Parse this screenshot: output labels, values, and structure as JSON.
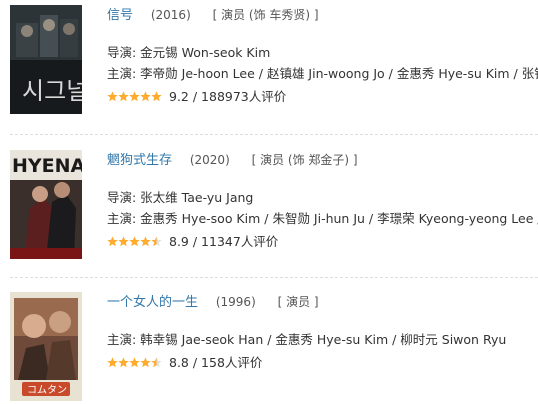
{
  "colors": {
    "link": "#3377aa",
    "star": "#ffac2d",
    "star_empty": "#e0e0e0",
    "text": "#333333"
  },
  "items": [
    {
      "title": "信号",
      "year": "(2016)",
      "role": "[ 演员 (饰 车秀贤) ]",
      "director_line": "导演: 金元锡 Won-seok Kim",
      "cast_line": "主演: 李帝勋 Je-hoon Lee / 赵镇雄 Jin-woong Jo / 金惠秀 Hye-su Kim / 张铉",
      "rating_text": "9.2 / 188973人评价",
      "stars": 5
    },
    {
      "title": "魍狗式生存",
      "year": "(2020)",
      "role": "[ 演员 (饰 郑金子) ]",
      "director_line": "导演: 张太维 Tae-yu Jang",
      "cast_line": "主演: 金惠秀 Hye-soo Kim / 朱智勋 Ji-hun Ju / 李璟荣 Kyeong-yeong Lee /",
      "rating_text": "8.9 / 11347人评价",
      "stars": 4.5
    },
    {
      "title": "一个女人的一生",
      "year": "(1996)",
      "role": "[ 演员 ]",
      "cast_line": "主演: 韩幸锡 Jae-seok Han / 金惠秀 Hye-su Kim / 柳时元 Siwon Ryu",
      "rating_text": "8.8 / 158人评价",
      "stars": 4.5
    }
  ]
}
